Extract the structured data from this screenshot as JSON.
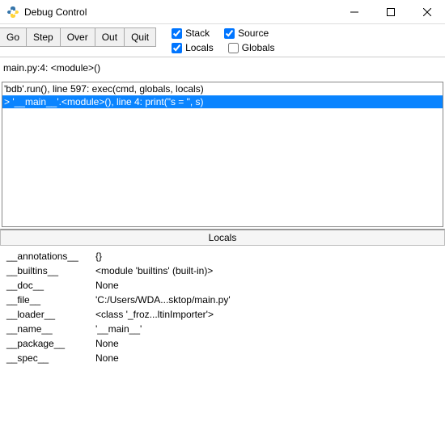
{
  "window": {
    "title": "Debug Control"
  },
  "toolbar": {
    "go": "Go",
    "step": "Step",
    "over": "Over",
    "out": "Out",
    "quit": "Quit"
  },
  "checks": {
    "stack": {
      "label": "Stack",
      "checked": true
    },
    "source": {
      "label": "Source",
      "checked": true
    },
    "locals": {
      "label": "Locals",
      "checked": true
    },
    "globals": {
      "label": "Globals",
      "checked": false
    }
  },
  "status": "main.py:4: <module>()",
  "stack": [
    "'bdb'.run(), line 597: exec(cmd, globals, locals)",
    "> '__main__'.<module>(), line 4: print(\"s = \", s)"
  ],
  "stack_selected": 1,
  "locals_header": "Locals",
  "locals": [
    {
      "key": "__annotations__",
      "value": "{}"
    },
    {
      "key": "__builtins__",
      "value": "<module 'builtins' (built-in)>"
    },
    {
      "key": "__doc__",
      "value": "None"
    },
    {
      "key": "__file__",
      "value": "'C:/Users/WDA...sktop/main.py'"
    },
    {
      "key": "__loader__",
      "value": "<class '_froz...ltinImporter'>"
    },
    {
      "key": "__name__",
      "value": "'__main__'"
    },
    {
      "key": "__package__",
      "value": "None"
    },
    {
      "key": "__spec__",
      "value": "None"
    }
  ]
}
